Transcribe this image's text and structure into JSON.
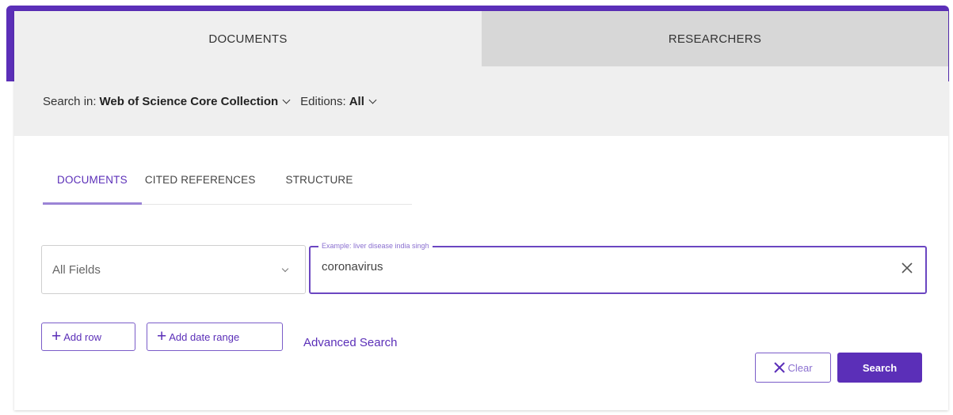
{
  "top_tabs": [
    {
      "label": "DOCUMENTS",
      "active": true
    },
    {
      "label": "RESEARCHERS",
      "active": false
    }
  ],
  "search_scope": {
    "search_in_label": "Search in:",
    "collection": "Web of Science Core Collection",
    "editions_label": "Editions:",
    "editions_value": "All"
  },
  "sub_tabs": [
    {
      "label": "DOCUMENTS",
      "active": true
    },
    {
      "label": "CITED REFERENCES",
      "active": false
    },
    {
      "label": "STRUCTURE",
      "active": false
    }
  ],
  "query": {
    "field_select_value": "All Fields",
    "example_hint": "Example: liver disease india singh",
    "input_value": "coronavirus"
  },
  "actions": {
    "add_row": "Add row",
    "add_date_range": "Add date range",
    "advanced_search": "Advanced Search",
    "clear": "Clear",
    "search": "Search"
  },
  "colors": {
    "brand_purple": "#5b2fb8",
    "tab_inactive_bg": "#d7d7d7",
    "panel_bg": "#efefef"
  },
  "icons": [
    "chevron-down-icon",
    "close-icon",
    "plus-icon"
  ]
}
